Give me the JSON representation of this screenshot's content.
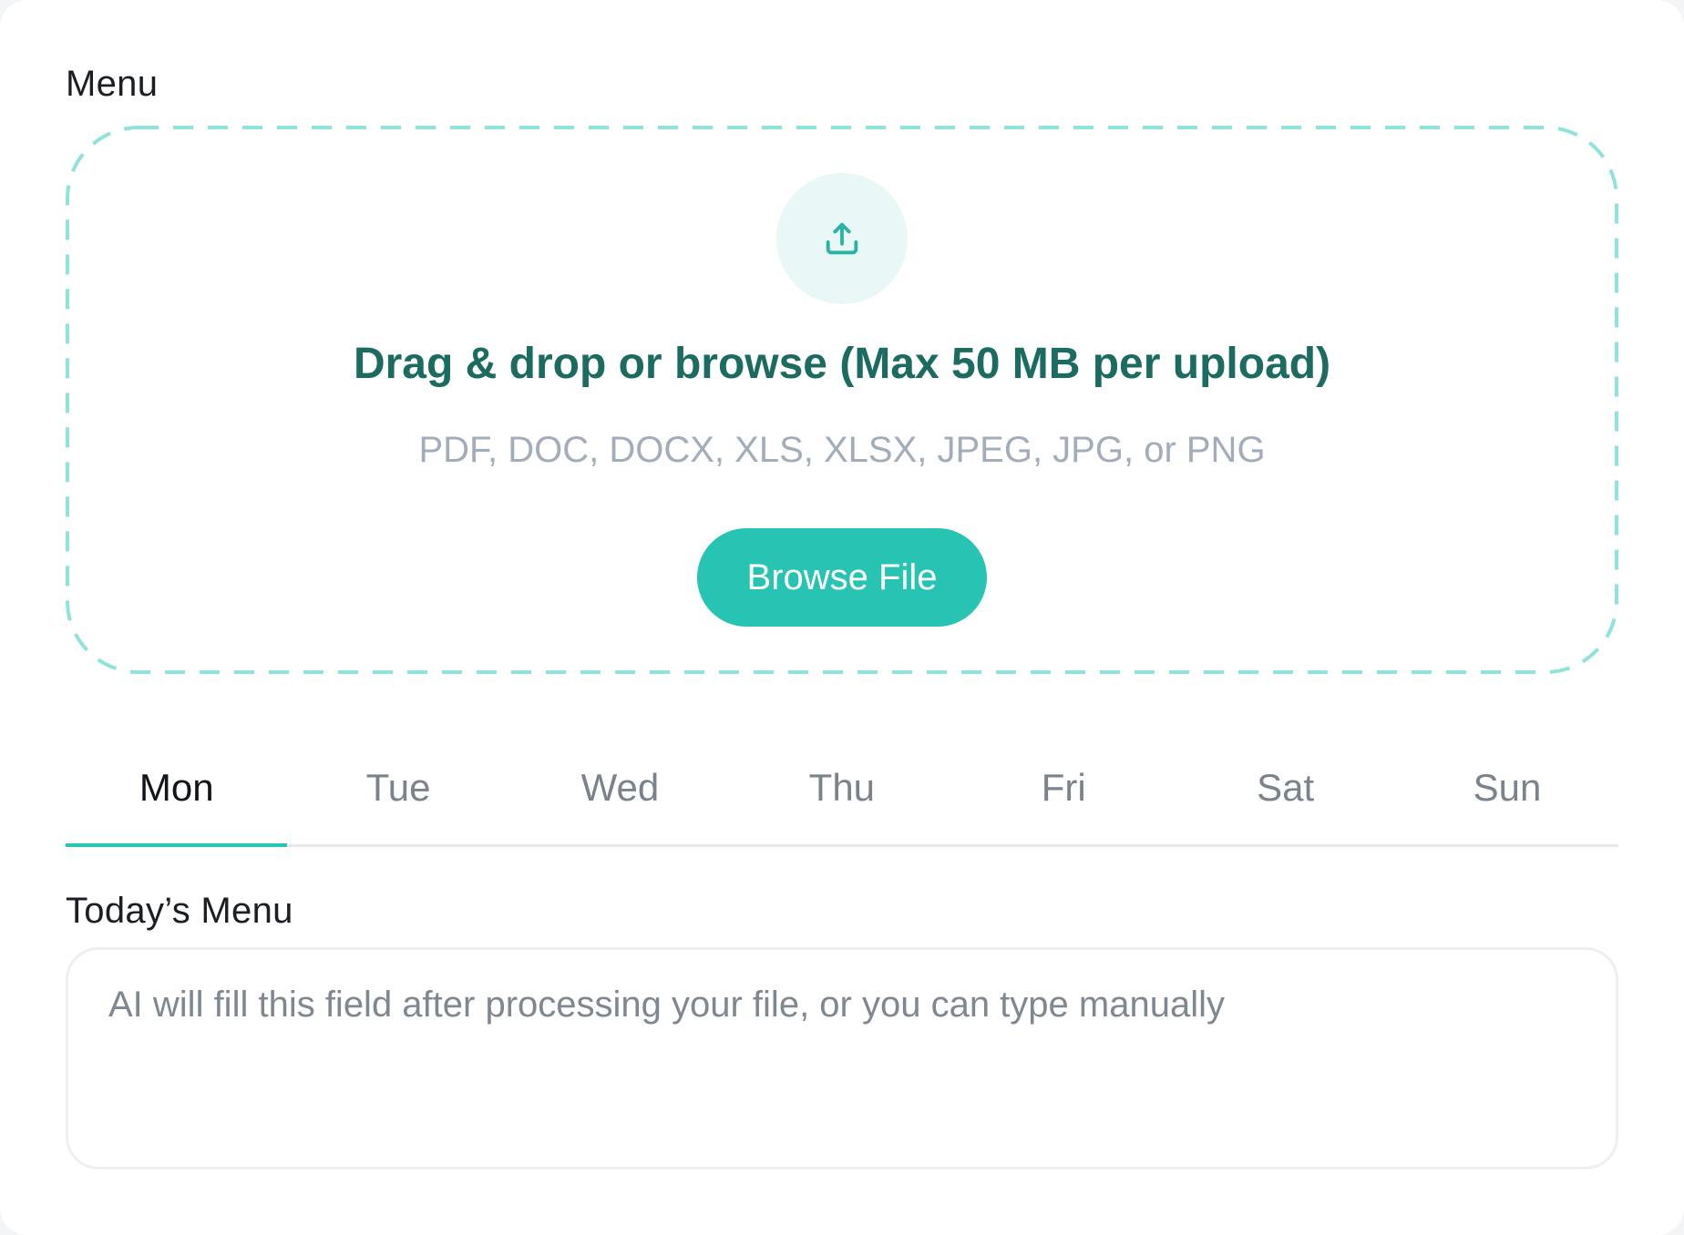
{
  "menu_section": {
    "label": "Menu"
  },
  "upload": {
    "icon": "upload-icon",
    "title": "Drag & drop or browse (Max 50 MB per upload)",
    "formats": "PDF, DOC, DOCX, XLS, XLSX, JPEG, JPG, or PNG",
    "browse_label": "Browse File"
  },
  "days": {
    "tabs": [
      {
        "label": "Mon",
        "active": true
      },
      {
        "label": "Tue",
        "active": false
      },
      {
        "label": "Wed",
        "active": false
      },
      {
        "label": "Thu",
        "active": false
      },
      {
        "label": "Fri",
        "active": false
      },
      {
        "label": "Sat",
        "active": false
      },
      {
        "label": "Sun",
        "active": false
      }
    ]
  },
  "todays_menu": {
    "label": "Today’s Menu",
    "value": "",
    "placeholder": "AI will fill this field after processing your file, or you can type manually"
  },
  "colors": {
    "accent": "#27c3b3",
    "accent_dark": "#1b6b60",
    "dashed_border": "#8fe3da",
    "upload_circle_bg": "#e9f8f6",
    "muted_text": "#a3adb9"
  }
}
